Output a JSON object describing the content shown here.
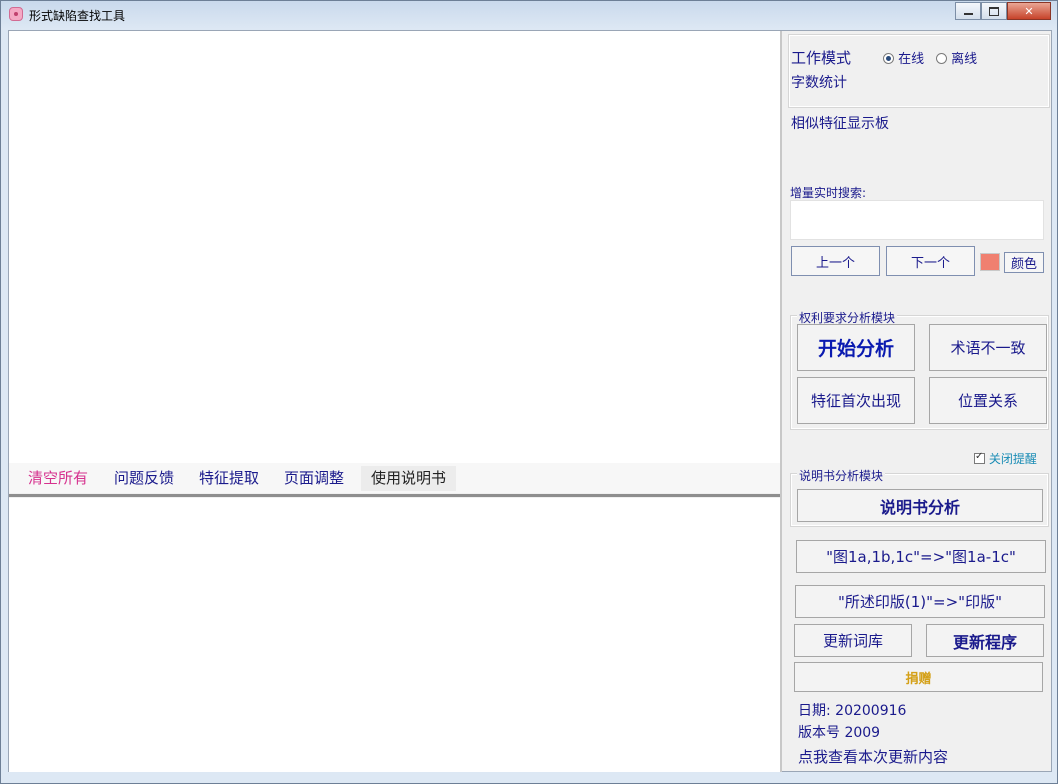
{
  "window": {
    "title": "形式缺陷查找工具"
  },
  "menu": {
    "items": [
      {
        "label": "清空所有"
      },
      {
        "label": "问题反馈"
      },
      {
        "label": "特征提取"
      },
      {
        "label": "页面调整"
      },
      {
        "label": "使用说明书"
      }
    ]
  },
  "mode": {
    "label": "工作模式",
    "online": "在线",
    "offline": "离线",
    "selected": "在线",
    "word_count_label": "字数统计"
  },
  "similar": {
    "title": "相似特征显示板"
  },
  "search": {
    "label": "增量实时搜索:",
    "value": "",
    "prev": "上一个",
    "next": "下一个",
    "color_button": "颜色",
    "highlight_color": "#f08070"
  },
  "claims": {
    "title": "权利要求分析模块",
    "start": "开始分析",
    "term_mismatch": "术语不一致",
    "first_occurrence": "特征首次出现",
    "position": "位置关系"
  },
  "close_reminder": {
    "label": "关闭提醒",
    "checked": true
  },
  "spec": {
    "title": "说明书分析模块",
    "analyze": "说明书分析"
  },
  "convert": {
    "figures": "\"图1a,1b,1c\"=>\"图1a-1c\"",
    "plate": "\"所述印版(1)\"=>\"印版\""
  },
  "update": {
    "lexicon": "更新词库",
    "program": "更新程序",
    "donate": "捐赠"
  },
  "info": {
    "date": "日期: 20200916",
    "version": "版本号 2009",
    "changelog": "点我查看本次更新内容"
  }
}
